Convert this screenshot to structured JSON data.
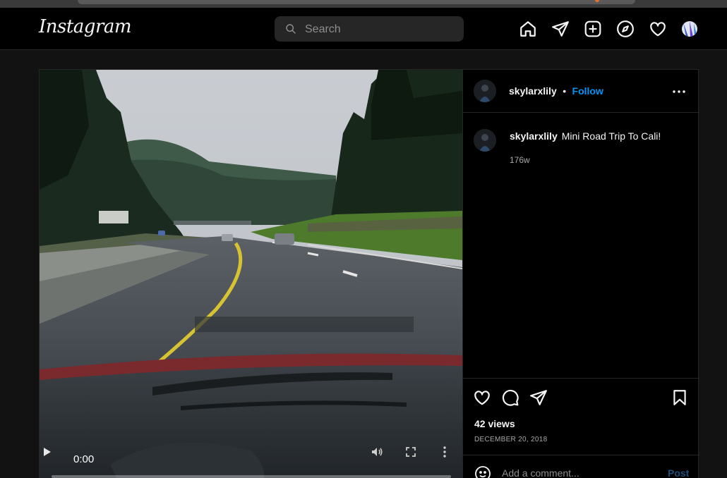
{
  "app": {
    "logo": "Instagram"
  },
  "search": {
    "placeholder": "Search"
  },
  "nav": {
    "icons": [
      "home-icon",
      "direct-messages-icon",
      "new-post-icon",
      "explore-icon",
      "activity-heart-icon",
      "profile-avatar"
    ]
  },
  "post": {
    "username": "skylarxlily",
    "separator": "•",
    "follow_label": "Follow",
    "caption": "Mini Road Trip To Cali!",
    "age": "176w",
    "views": "42 views",
    "date": "DECEMBER 20, 2018"
  },
  "video": {
    "time": "0:00",
    "progress": 0
  },
  "comment": {
    "placeholder": "Add a comment...",
    "post_label": "Post"
  },
  "colors": {
    "accent": "#0095f6",
    "background": "#121212",
    "panel": "#000000",
    "border": "#262626"
  }
}
